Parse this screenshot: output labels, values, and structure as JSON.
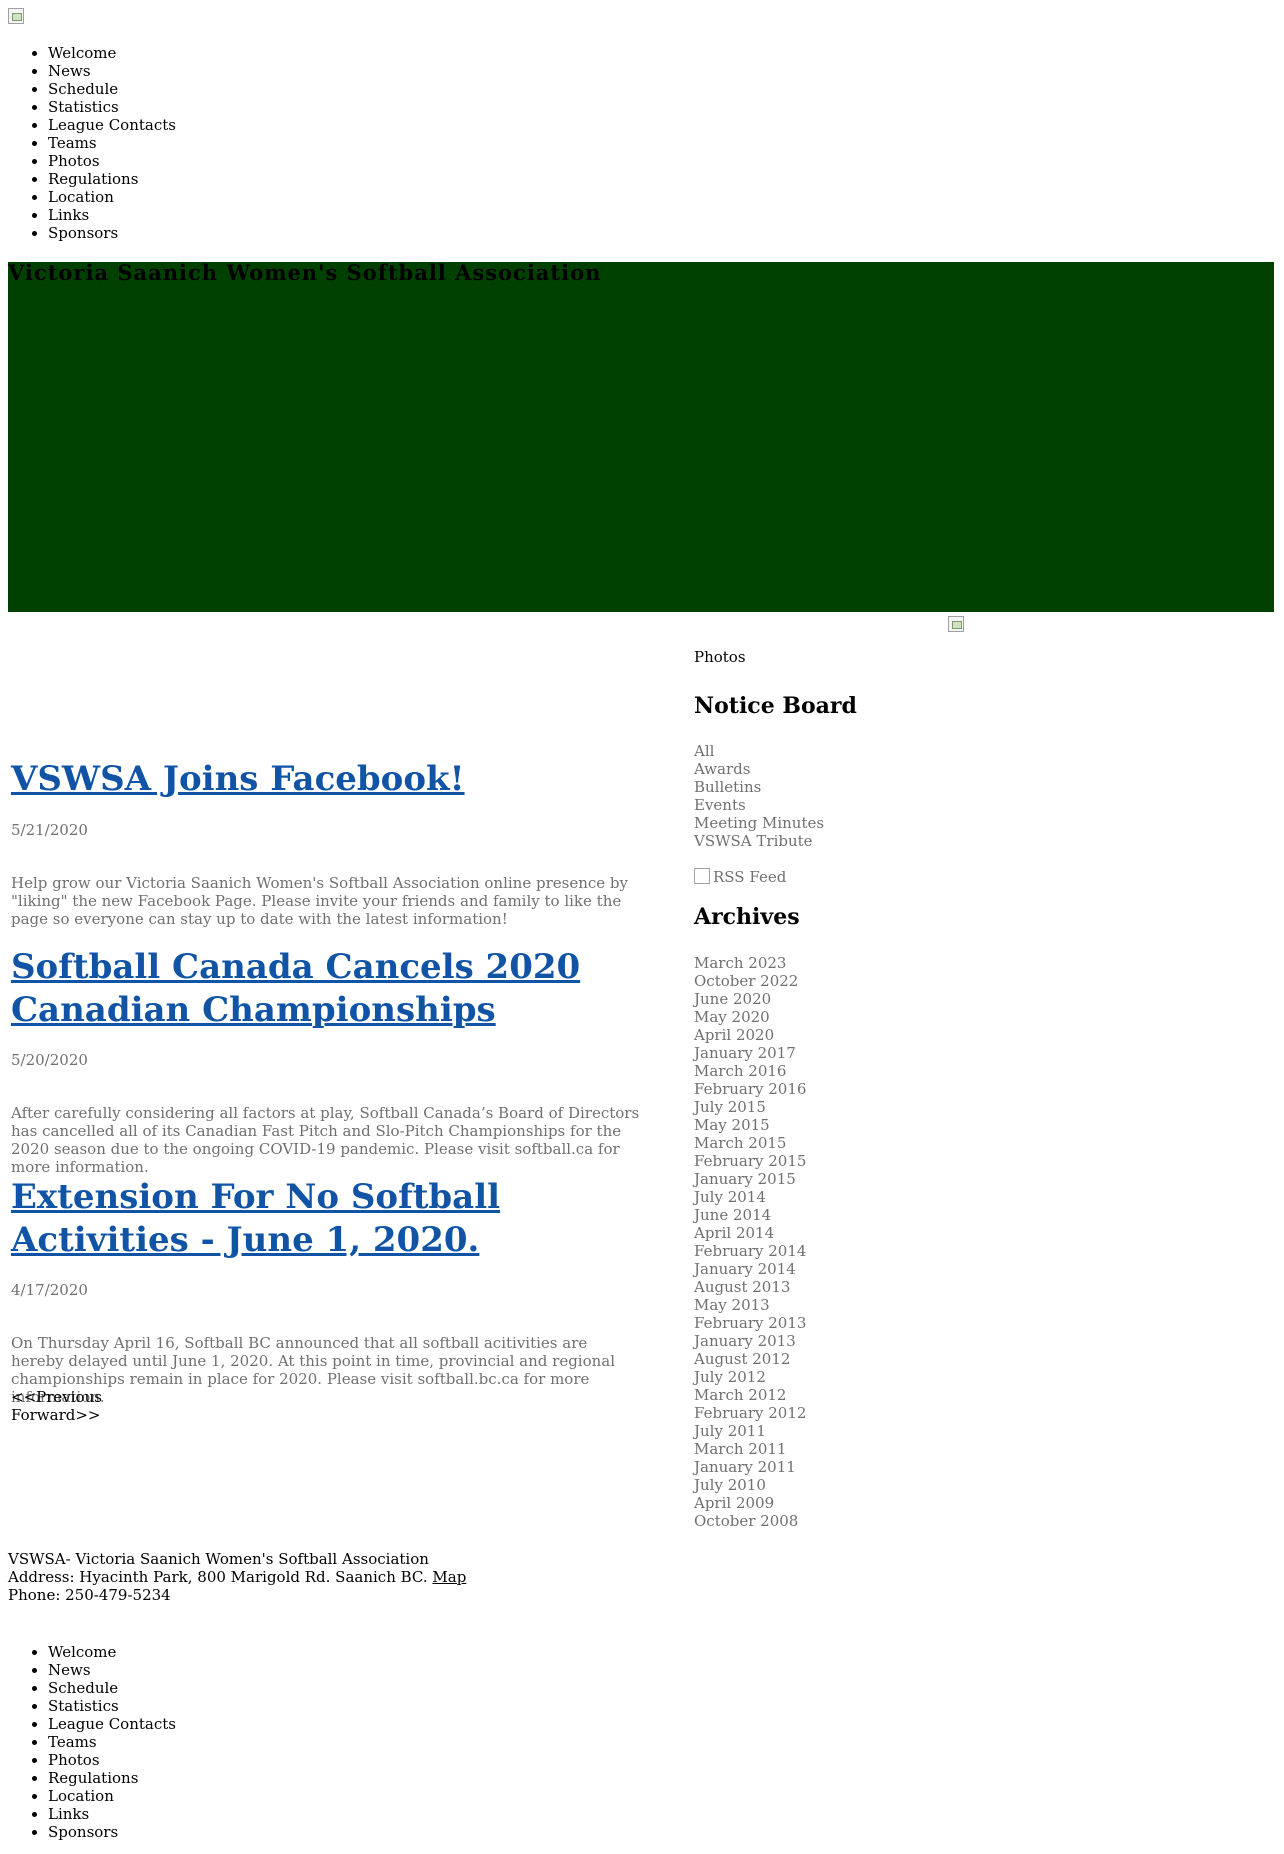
{
  "nav": [
    "Welcome",
    "News",
    "Schedule",
    "Statistics",
    "League Contacts",
    "Teams",
    "Photos",
    "Regulations",
    "Location",
    "Links",
    "Sponsors"
  ],
  "banner": {
    "title": "Victoria Saanich Women's Softball Association",
    "background": "#004000"
  },
  "sidebar": {
    "photos_label": "Photos",
    "notice_heading": "Notice Board",
    "notice_items": [
      "All",
      "Awards",
      "Bulletins",
      "Events",
      "Meeting Minutes",
      "VSWSA Tribute"
    ],
    "rss_label": "RSS Feed",
    "archives_heading": "Archives",
    "archives": [
      "March 2023",
      "October 2022",
      "June 2020",
      "May 2020",
      "April 2020",
      "January 2017",
      "March 2016",
      "February 2016",
      "July 2015",
      "May 2015",
      "March 2015",
      "February 2015",
      "January 2015",
      "July 2014",
      "June 2014",
      "April 2014",
      "February 2014",
      "January 2014",
      "August 2013",
      "May 2013",
      "February 2013",
      "January 2013",
      "August 2012",
      "July 2012",
      "March 2012",
      "February 2012",
      "July 2011",
      "March 2011",
      "January 2011",
      "July 2010",
      "April 2009",
      "October 2008"
    ]
  },
  "posts": [
    {
      "title": "VSWSA Joins Facebook!",
      "date": "5/21/2020",
      "body": "Help grow our Victoria Saanich Women's Softball Association online presence by \"liking\" the new Facebook Page. Please invite your friends and family to like the page so everyone can stay up to date with the latest information!"
    },
    {
      "title": "Softball Canada Cancels 2020 Canadian Championships",
      "date": "5/20/2020",
      "body": "After carefully considering all factors at play, Softball Canada’s Board of Directors has cancelled all of its Canadian Fast Pitch and Slo-Pitch Championships for the 2020 season due to the ongoing COVID-19 pandemic. Please visit softball.ca for more information."
    },
    {
      "title": "Extension For No Softball Activities - June 1, 2020.",
      "date": "4/17/2020",
      "body": "On Thursday April 16, Softball BC announced that all softball acitivities are hereby delayed until June 1, 2020. At this point in time, provincial and regional championships remain in place for 2020. Please visit softball.bc.ca for more information."
    }
  ],
  "pager": {
    "previous": "<<Previous",
    "forward": "Forward>>"
  },
  "footer": {
    "org": "VSWSA- Victoria Saanich Women's Softball Association",
    "address": "Address: Hyacinth Park, 800 Marigold Rd. Saanich BC.",
    "map_link": "Map",
    "phone": "Phone: 250-479-5234"
  },
  "colors": {
    "link_blue": "#1154a6",
    "muted_text": "#707070"
  }
}
